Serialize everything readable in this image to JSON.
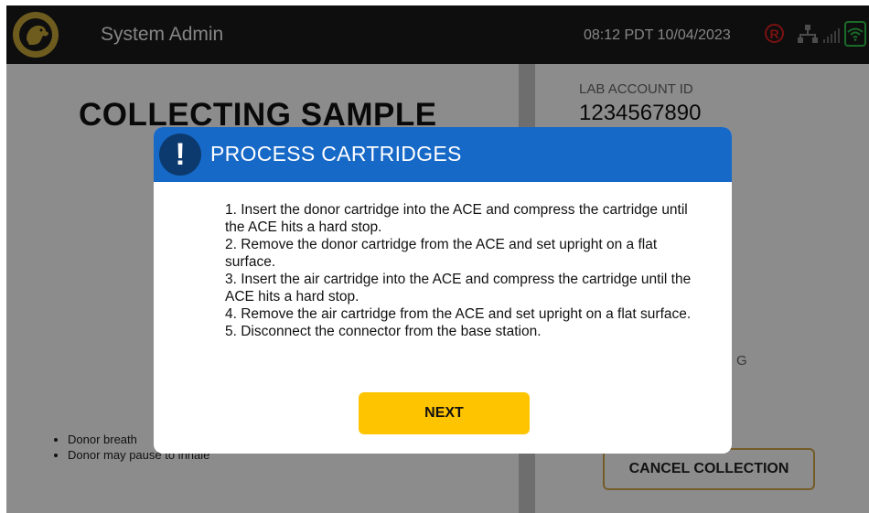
{
  "header": {
    "title": "System Admin",
    "datetime": "08:12 PDT  10/04/2023",
    "status_r": "R",
    "logo_icon": "dog-logo-icon",
    "icons": [
      "network-icon",
      "signal-icon",
      "wifi-icon"
    ]
  },
  "main": {
    "heading": "COLLECTING SAMPLE",
    "lab_account_label": "LAB ACCOUNT ID",
    "lab_account_value": "1234567890",
    "partial_text": "G",
    "tips": [
      "Donor breath",
      "Donor may pause to inhale"
    ],
    "cancel_label": "CANCEL COLLECTION"
  },
  "modal": {
    "icon": "!",
    "title": "PROCESS CARTRIDGES",
    "steps": [
      "1. Insert the donor cartridge into the ACE and compress the cartridge until the ACE hits a hard stop.",
      "2. Remove the donor cartridge from the ACE and set upright on a flat surface.",
      "3. Insert the air cartridge into the ACE and compress the cartridge until the ACE hits a hard stop.",
      "4. Remove the air cartridge from the ACE and set upright on a flat surface.",
      "5. Disconnect the connector from the base station."
    ],
    "next_label": "NEXT"
  },
  "colors": {
    "header_bg": "#1b1b1b",
    "modal_header": "#1769c8",
    "next_button": "#ffc400",
    "cancel_border": "#d4a84a",
    "status_red": "#e02020",
    "wifi_green": "#31c24a"
  }
}
